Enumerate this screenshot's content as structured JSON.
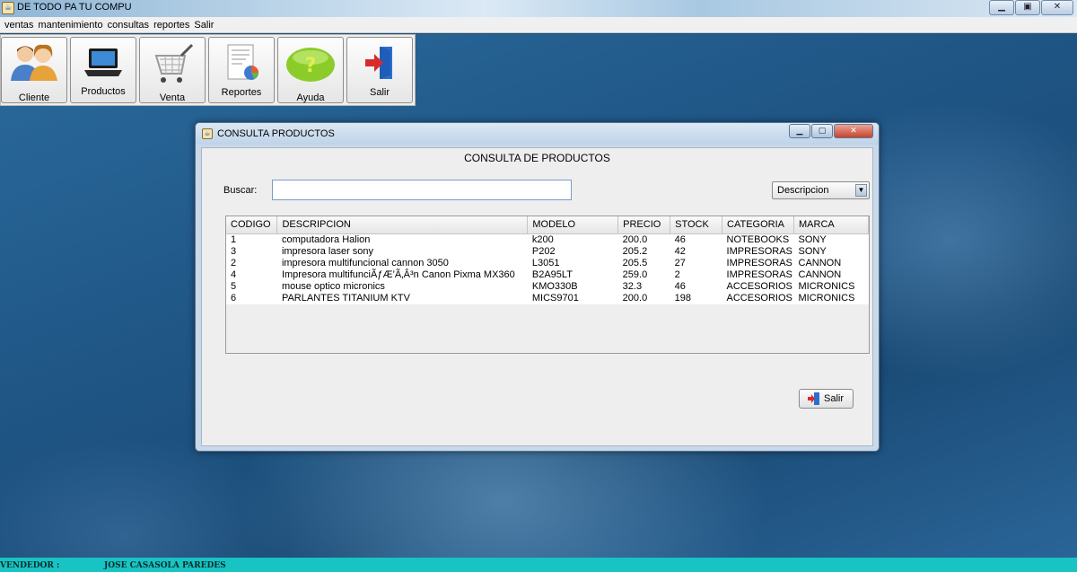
{
  "window": {
    "title": "DE TODO PA TU COMPU"
  },
  "menu": [
    "ventas",
    "mantenimiento",
    "consultas",
    "reportes",
    "Salir"
  ],
  "toolbar": {
    "buttons": [
      {
        "label": "Cliente",
        "icon": "users-icon"
      },
      {
        "label": "Productos",
        "icon": "laptop-icon"
      },
      {
        "label": "Venta",
        "icon": "shopping-cart-icon"
      },
      {
        "label": "Reportes",
        "icon": "report-chart-icon"
      },
      {
        "label": "Ayuda",
        "icon": "help-icon"
      },
      {
        "label": "Salir",
        "icon": "exit-door-icon"
      }
    ]
  },
  "dialog": {
    "title": "CONSULTA PRODUCTOS",
    "heading": "CONSULTA DE PRODUCTOS",
    "search_label": "Buscar:",
    "search_value": "",
    "filter_selected": "Descripcion",
    "columns": [
      "CODIGO",
      "DESCRIPCION",
      "MODELO",
      "PRECIO",
      "STOCK",
      "CATEGORIA",
      "MARCA"
    ],
    "rows": [
      [
        "1",
        "computadora Halion",
        "k200",
        "200.0",
        "46",
        "NOTEBOOKS",
        "SONY"
      ],
      [
        "3",
        "impresora laser sony",
        "P202",
        "205.2",
        "42",
        "IMPRESORAS",
        "SONY"
      ],
      [
        "2",
        "impresora multifuncional cannon 3050",
        "L3051",
        "205.5",
        "27",
        "IMPRESORAS",
        "CANNON"
      ],
      [
        "4",
        "Impresora multifunciÃƒÆ’Ã‚Â³n Canon Pixma MX360",
        "B2A95LT",
        "259.0",
        "2",
        "IMPRESORAS",
        "CANNON"
      ],
      [
        "5",
        "mouse optico micronics",
        "KMO330B",
        "32.3",
        "46",
        "ACCESORIOS",
        "MICRONICS"
      ],
      [
        "6",
        "PARLANTES TITANIUM KTV",
        "MICS9701",
        "200.0",
        "198",
        "ACCESORIOS",
        "MICRONICS"
      ]
    ],
    "salir_label": "Salir"
  },
  "status": {
    "vendedor_label": "VENDEDOR :",
    "vendedor_value": "JOSE CASASOLA  PAREDES"
  }
}
